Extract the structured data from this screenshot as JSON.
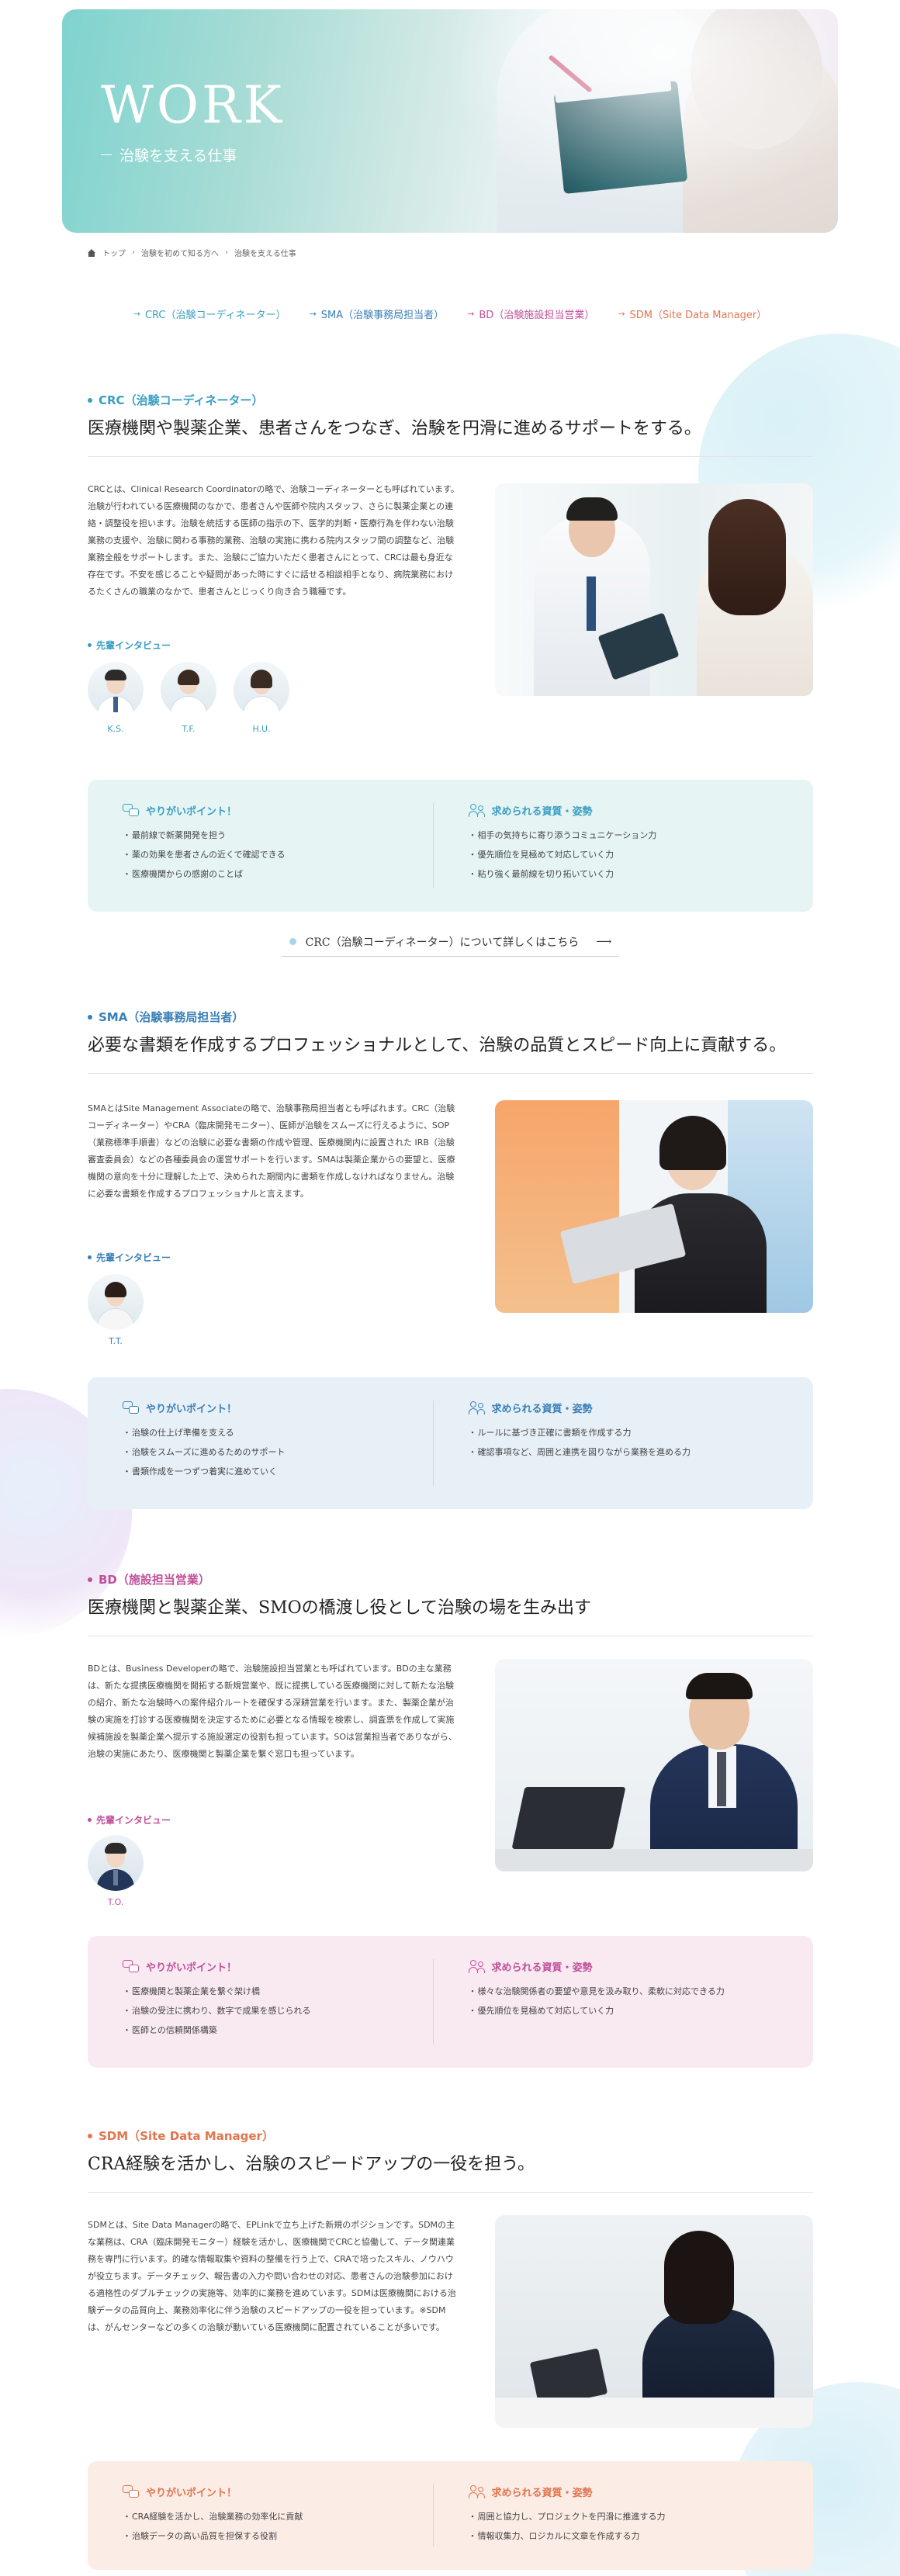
{
  "hero": {
    "title": "WORK",
    "subtitle": "治験を支える仕事"
  },
  "breadcrumb": {
    "home": "トップ",
    "level2": "治験を初めて知る方へ",
    "current": "治験を支える仕事"
  },
  "anchors": [
    {
      "label": "CRC（治験コーディネーター）",
      "color": "#3a9ec2"
    },
    {
      "label": "SMA（治験事務局担当者）",
      "color": "#3a7fb8"
    },
    {
      "label": "BD（治験施設担当営業）",
      "color": "#c0509a"
    },
    {
      "label": "SDM（Site Data Manager）",
      "color": "#e0764f"
    }
  ],
  "crc": {
    "label": "CRC（治験コーディネーター）",
    "heading": "医療機関や製薬企業、患者さんをつなぎ、治験を円滑に進めるサポートをする。",
    "text": "CRCとは、Clinical Research Coordinatorの略で、治験コーディネーターとも呼ばれています。治験が行われている医療機関のなかで、患者さんや医師や院内スタッフ、さらに製薬企業との連絡・調整役を担います。治験を統括する医師の指示の下、医学的判断・医療行為を伴わない治験業務の支援や、治験に関わる事務的業務、治験の実施に携わる院内スタッフ間の調整など、治験業務全般をサポートします。また、治験にご協力いただく患者さんにとって、CRCは最も身近な存在です。不安を感じることや疑問があった時にすぐに話せる相談相手となり、病院業務におけるたくさんの職業のなかで、患者さんとじっくり向き合う職種です。",
    "interview_label": "先輩インタビュー",
    "interviewees": [
      "K.S.",
      "T.F.",
      "H.U."
    ],
    "points_title": "やりがいポイント！",
    "points": [
      "最前線で新薬開発を担う",
      "薬の効果を患者さんの近くで確認できる",
      "医療機関からの感謝のことば"
    ],
    "skills_title": "求められる資質・姿勢",
    "skills": [
      "相手の気持ちに寄り添うコミュニケーション力",
      "優先順位を見極めて対応していく力",
      "粘り強く最前線を切り拓いていく力"
    ],
    "link": "CRC（治験コーディネーター）について詳しくはこちら"
  },
  "sma": {
    "label": "SMA（治験事務局担当者）",
    "heading": "必要な書類を作成するプロフェッショナルとして、治験の品質とスピード向上に貢献する。",
    "text": "SMAとはSite Management Associateの略で、治験事務局担当者とも呼ばれます。CRC（治験コーディネーター）やCRA（臨床開発モニター）、医師が治験をスムーズに行えるように、SOP（業務標準手順書）などの治験に必要な書類の作成や管理、医療機関内に設置された IRB（治験審査委員会）などの各種委員会の運営サポートを行います。SMAは製薬企業からの要望と、医療機関の意向を十分に理解した上で、決められた期間内に書類を作成しなければなりません。治験に必要な書類を作成するプロフェッショナルと言えます。",
    "interview_label": "先輩インタビュー",
    "interviewees": [
      "T.T."
    ],
    "points_title": "やりがいポイント！",
    "points": [
      "治験の仕上げ準備を支える",
      "治験をスムーズに進めるためのサポート",
      "書類作成を一つずつ着実に進めていく"
    ],
    "skills_title": "求められる資質・姿勢",
    "skills": [
      "ルールに基づき正確に書類を作成する力",
      "確認事項など、周囲と連携を図りながら業務を進める力"
    ]
  },
  "bd": {
    "label": "BD（施設担当営業）",
    "heading": "医療機関と製薬企業、SMOの橋渡し役として治験の場を生み出す",
    "text": "BDとは、Business Developerの略で、治験施設担当営業とも呼ばれています。BDの主な業務は、新たな提携医療機関を開拓する新規営業や、既に提携している医療機関に対して新たな治験の紹介、新たな治験時への案件紹介ルートを確保する深耕営業を行います。また、製薬企業が治験の実施を打診する医療機関を決定するために必要となる情報を検索し、調査票を作成して実施候補施設を製薬企業へ提示する施設選定の役割も担っています。SOは営業担当者でありながら、治験の実施にあたり、医療機関と製薬企業を繋ぐ窓口も担っています。",
    "interview_label": "先輩インタビュー",
    "interviewees": [
      "T.O."
    ],
    "points_title": "やりがいポイント！",
    "points": [
      "医療機関と製薬企業を繋ぐ架け橋",
      "治験の受注に携わり、数字で成果を感じられる",
      "医師との信頼関係構築"
    ],
    "skills_title": "求められる資質・姿勢",
    "skills": [
      "様々な治験関係者の要望や意見を汲み取り、柔軟に対応できる力",
      "優先順位を見極めて対応していく力"
    ]
  },
  "sdm": {
    "label": "SDM（Site Data Manager）",
    "heading": "CRA経験を活かし、治験のスピードアップの一役を担う。",
    "text": "SDMとは、Site Data Managerの略で、EPLinkで立ち上げた新規のポジションです。SDMの主な業務は、CRA（臨床開発モニター）経験を活かし、医療機関でCRCと協働して、データ関連業務を専門に行います。的確な情報取集や資料の整備を行う上で、CRAで培ったスキル、ノウハウが役立ちます。データチェック、報告書の入力や問い合わせの対応、患者さんの治験参加における適格性のダブルチェックの実施等、効率的に業務を進めています。SDMは医療機関における治験データの品質向上、業務効率化に伴う治験のスピードアップの一役を担っています。※SDMは、がんセンターなどの多くの治験が動いている医療機関に配置されていることが多いです。",
    "points_title": "やりがいポイント！",
    "points": [
      "CRA経験を活かし、治験業務の効率化に貢献",
      "治験データの高い品質を担保する役割"
    ],
    "skills_title": "求められる資質・姿勢",
    "skills": [
      "周囲と協力し、プロジェクトを円滑に推進する力",
      "情報収集力、ロジカルに文章を作成する力"
    ]
  },
  "colors": {
    "crc": "#3a9ec2",
    "sma": "#3a7fb8",
    "bd": "#c0509a",
    "sdm": "#e0764f",
    "crc_box": "#e6f4f4",
    "sma_box": "#e8f0f7",
    "bd_box": "#f9eaf2",
    "sdm_box": "#fcece6"
  }
}
